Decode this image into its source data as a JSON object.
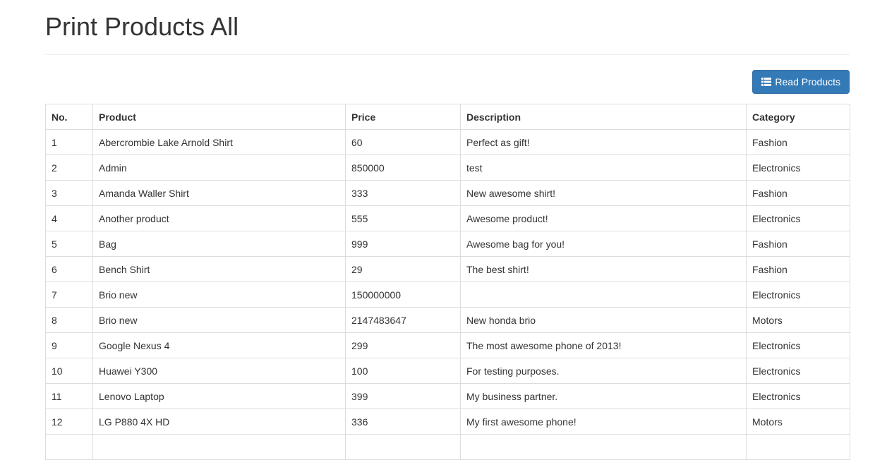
{
  "page": {
    "title": "Print Products All"
  },
  "toolbar": {
    "read_products_label": "Read Products",
    "read_products_icon": "list-icon"
  },
  "table": {
    "headers": [
      "No.",
      "Product",
      "Price",
      "Description",
      "Category"
    ],
    "rows": [
      [
        "1",
        "Abercrombie Lake Arnold Shirt",
        "60",
        "Perfect as gift!",
        "Fashion"
      ],
      [
        "2",
        "Admin",
        "850000",
        "test",
        "Electronics"
      ],
      [
        "3",
        "Amanda Waller Shirt",
        "333",
        "New awesome shirt!",
        "Fashion"
      ],
      [
        "4",
        "Another product",
        "555",
        "Awesome product!",
        "Electronics"
      ],
      [
        "5",
        "Bag",
        "999",
        "Awesome bag for you!",
        "Fashion"
      ],
      [
        "6",
        "Bench Shirt",
        "29",
        "The best shirt!",
        "Fashion"
      ],
      [
        "7",
        "Brio new",
        "150000000",
        "",
        "Electronics"
      ],
      [
        "8",
        "Brio new",
        "2147483647",
        "New honda brio",
        "Motors"
      ],
      [
        "9",
        "Google Nexus 4",
        "299",
        "The most awesome phone of 2013!",
        "Electronics"
      ],
      [
        "10",
        "Huawei Y300",
        "100",
        "For testing purposes.",
        "Electronics"
      ],
      [
        "11",
        "Lenovo Laptop",
        "399",
        "My business partner.",
        "Electronics"
      ],
      [
        "12",
        "LG P880 4X HD",
        "336",
        "My first awesome phone!",
        "Motors"
      ],
      [
        "",
        "",
        "",
        "",
        ""
      ]
    ]
  },
  "colors": {
    "primary_button": "#337ab7",
    "border": "#dddddd",
    "text": "#333333"
  }
}
